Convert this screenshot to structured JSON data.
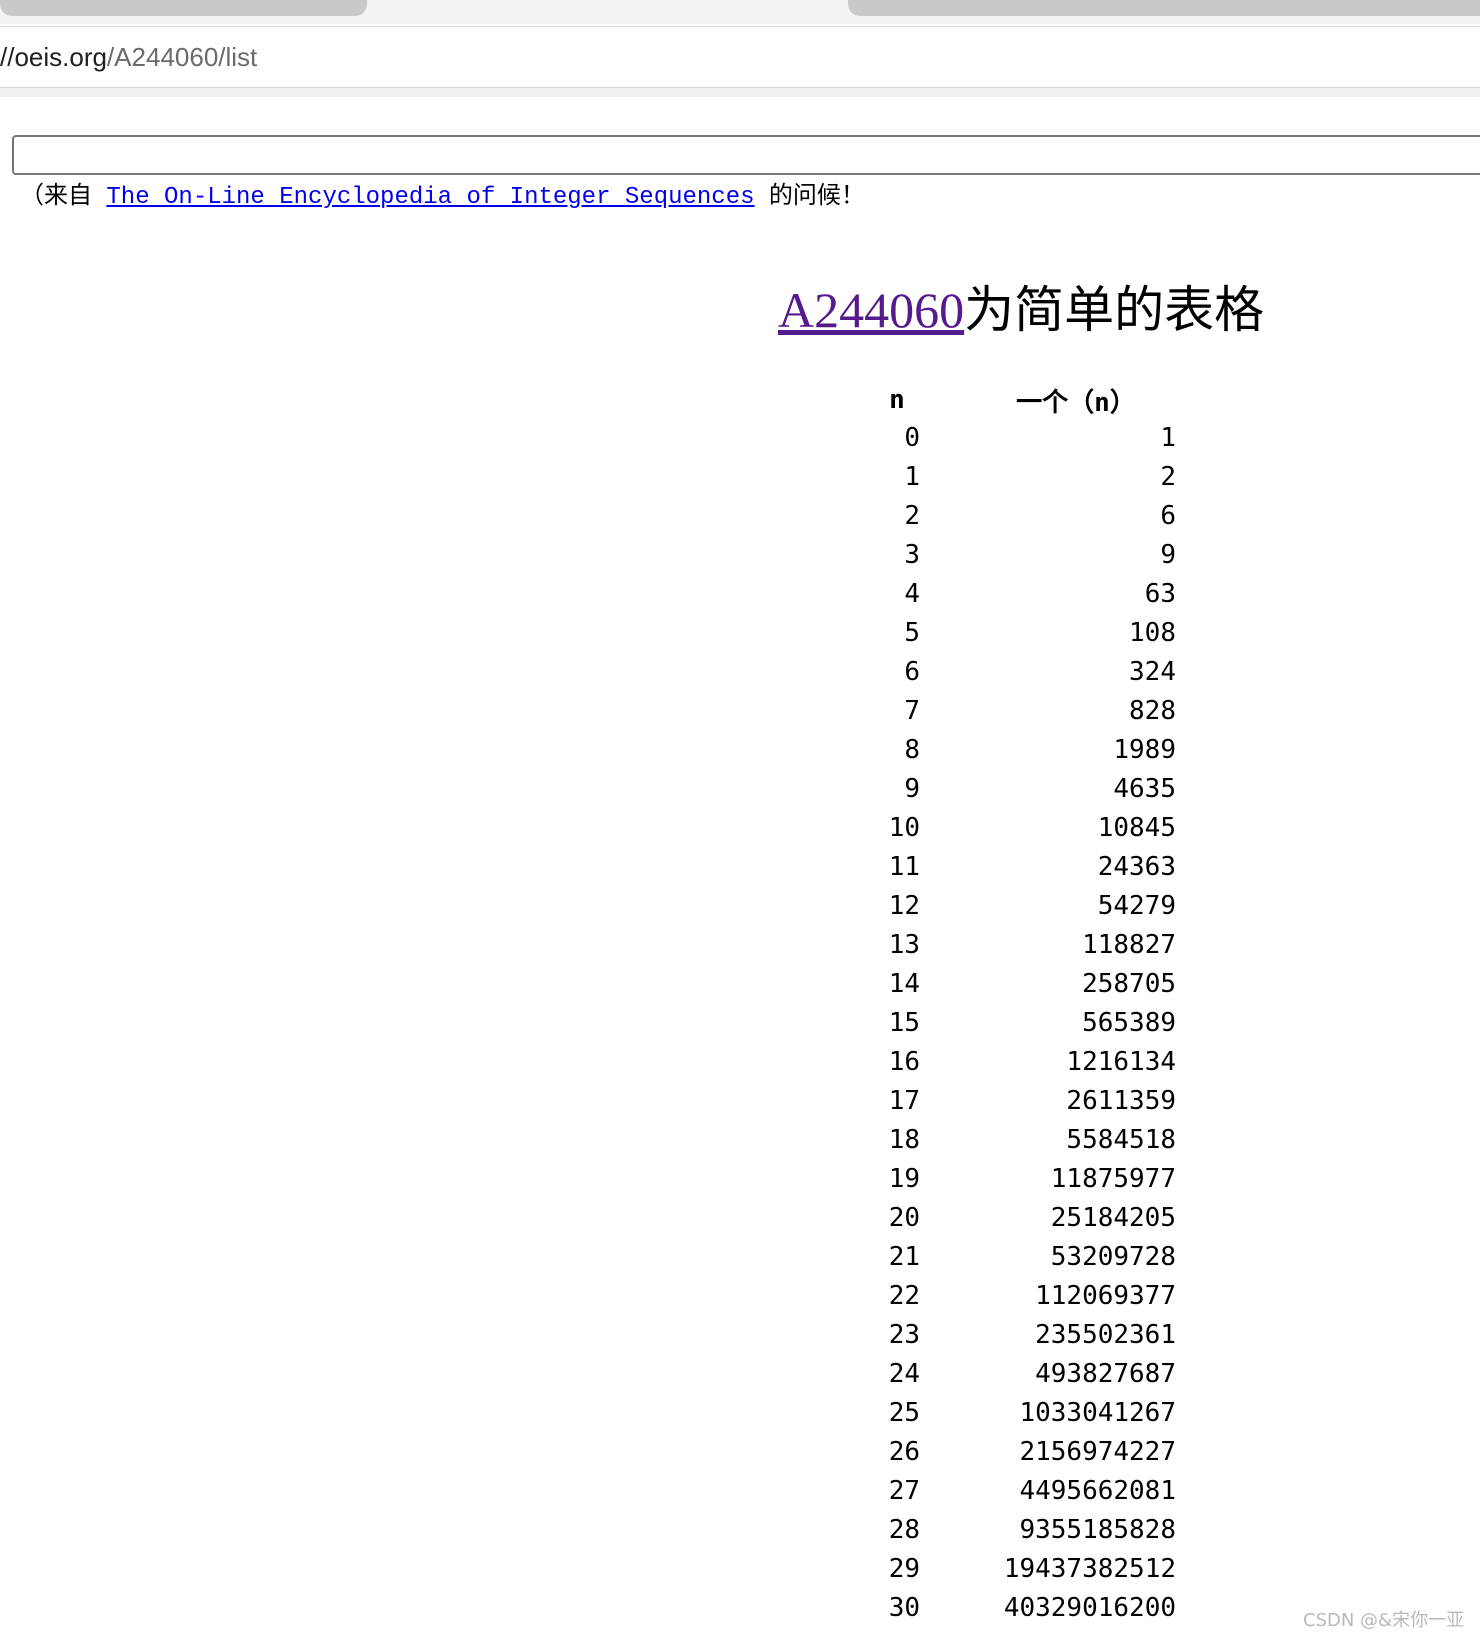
{
  "browser": {
    "url_host": "//oeis.org",
    "url_path": "/A244060/list"
  },
  "page": {
    "search_value": "",
    "greeting_prefix": "（来自 ",
    "greeting_link": "The On-Line Encyclopedia of Integer Sequences",
    "greeting_suffix": " 的问候！",
    "title_link": "A244060",
    "title_text": "为简单的表格"
  },
  "table": {
    "headers": {
      "n": "n",
      "a": "一个（n）"
    },
    "rows": [
      {
        "n": "0",
        "a": "1"
      },
      {
        "n": "1",
        "a": "2"
      },
      {
        "n": "2",
        "a": "6"
      },
      {
        "n": "3",
        "a": "9"
      },
      {
        "n": "4",
        "a": "63"
      },
      {
        "n": "5",
        "a": "108"
      },
      {
        "n": "6",
        "a": "324"
      },
      {
        "n": "7",
        "a": "828"
      },
      {
        "n": "8",
        "a": "1989"
      },
      {
        "n": "9",
        "a": "4635"
      },
      {
        "n": "10",
        "a": "10845"
      },
      {
        "n": "11",
        "a": "24363"
      },
      {
        "n": "12",
        "a": "54279"
      },
      {
        "n": "13",
        "a": "118827"
      },
      {
        "n": "14",
        "a": "258705"
      },
      {
        "n": "15",
        "a": "565389"
      },
      {
        "n": "16",
        "a": "1216134"
      },
      {
        "n": "17",
        "a": "2611359"
      },
      {
        "n": "18",
        "a": "5584518"
      },
      {
        "n": "19",
        "a": "11875977"
      },
      {
        "n": "20",
        "a": "25184205"
      },
      {
        "n": "21",
        "a": "53209728"
      },
      {
        "n": "22",
        "a": "112069377"
      },
      {
        "n": "23",
        "a": "235502361"
      },
      {
        "n": "24",
        "a": "493827687"
      },
      {
        "n": "25",
        "a": "1033041267"
      },
      {
        "n": "26",
        "a": "2156974227"
      },
      {
        "n": "27",
        "a": "4495662081"
      },
      {
        "n": "28",
        "a": "9355185828"
      },
      {
        "n": "29",
        "a": "19437382512"
      },
      {
        "n": "30",
        "a": "40329016200"
      }
    ]
  },
  "watermark": "CSDN @&宋你一亚"
}
